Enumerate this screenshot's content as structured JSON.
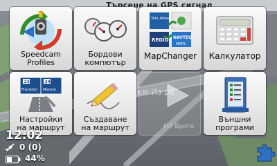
{
  "status": {
    "title": "Търсене на GPS сигнал"
  },
  "background": {
    "road_text_1": "км Из ре",
    "road_text_2": "ИИ Бриге"
  },
  "tiles": [
    {
      "id": "speedcam",
      "lines": [
        "Speedcam",
        "Profiles"
      ],
      "icon": "speedcam-icon"
    },
    {
      "id": "trip-computer",
      "lines": [
        "Бордови",
        "компютър"
      ],
      "icon": "gauges-icon"
    },
    {
      "id": "mapchanger",
      "lines": [
        "MapChanger"
      ],
      "icon": "mapchanger-icon"
    },
    {
      "id": "calculator",
      "lines": [
        "Калкулатор"
      ],
      "icon": "calculator-icon"
    },
    {
      "id": "route-settings",
      "lines": [
        "Настройки",
        "на маршрут"
      ],
      "icon": "route-settings-icon",
      "sign": {
        "top_left": "23",
        "top_right": "24",
        "bottom_left": "Franklyn",
        "bottom_right": "Marloe"
      }
    },
    {
      "id": "create-route",
      "lines": [
        "Създаване",
        "на маршрут"
      ],
      "icon": "pencil-icon"
    },
    {
      "id": "external-programs",
      "lines": [
        "Външни",
        "програми"
      ],
      "icon": "external-programs-icon"
    }
  ],
  "mapchanger_badges": {
    "tele_atlas": "Tele Atlas",
    "navteq": "NAVTEQ",
    "maps": "MAPS",
    "region": "REGIO"
  },
  "footer": {
    "time": "12:02",
    "satellites": "0 (0)",
    "battery": "44%"
  },
  "colors": {
    "tile_top": "#fafafa",
    "tile_bottom": "#d7d7d7",
    "accent_blue": "#1f5fa6"
  }
}
